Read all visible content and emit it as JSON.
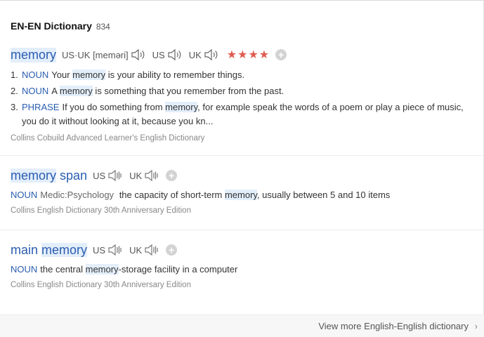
{
  "header": {
    "title": "EN-EN Dictionary",
    "count": "834"
  },
  "entries": [
    {
      "headword": "memory",
      "phonetic_us_uk": "US·UK [meməri]",
      "us": "US",
      "uk": "UK",
      "stars": "★★★★",
      "rating_stars": 4,
      "senses": [
        {
          "num": "1.",
          "pos": "NOUN",
          "pre": "Your ",
          "hl": "memory",
          "post": " is your ability to remember things."
        },
        {
          "num": "2.",
          "pos": "NOUN",
          "pre": "A ",
          "hl": "memory",
          "post": " is something that you remember from the past."
        },
        {
          "num": "3.",
          "pos": "PHRASE",
          "pre": "If you do something from ",
          "hl": "memory",
          "post": ", for example speak the words of a poem or play a piece of music, you do it without looking at it, because you kn..."
        }
      ],
      "source": "Collins Cobuild Advanced Learner's English Dictionary"
    },
    {
      "headword_a": "memory",
      "headword_b": " span",
      "us": "US",
      "uk": "UK",
      "pos": "NOUN",
      "domain": "Medic:Psychology",
      "pre": "the capacity of short-term ",
      "hl": "memory",
      "post": ", usually between 5 and 10 items",
      "source": "Collins English Dictionary 30th Anniversary Edition"
    },
    {
      "headword_a": "main ",
      "headword_b": "memory",
      "us": "US",
      "uk": "UK",
      "pos": "NOUN",
      "pre": "the central ",
      "hl": "memory",
      "post": "-storage facility in a computer",
      "source": "Collins English Dictionary 30th Anniversary Edition"
    }
  ],
  "footer": {
    "more": "View more English-English dictionary",
    "chevron": "›"
  },
  "icons": {
    "speaker": "speaker-icon",
    "add": "add-icon",
    "chevron": "chevron-right-icon"
  },
  "colors": {
    "headword": "#2a5db0",
    "highlight": "#e3eefb",
    "stars": "#e05a4e"
  }
}
